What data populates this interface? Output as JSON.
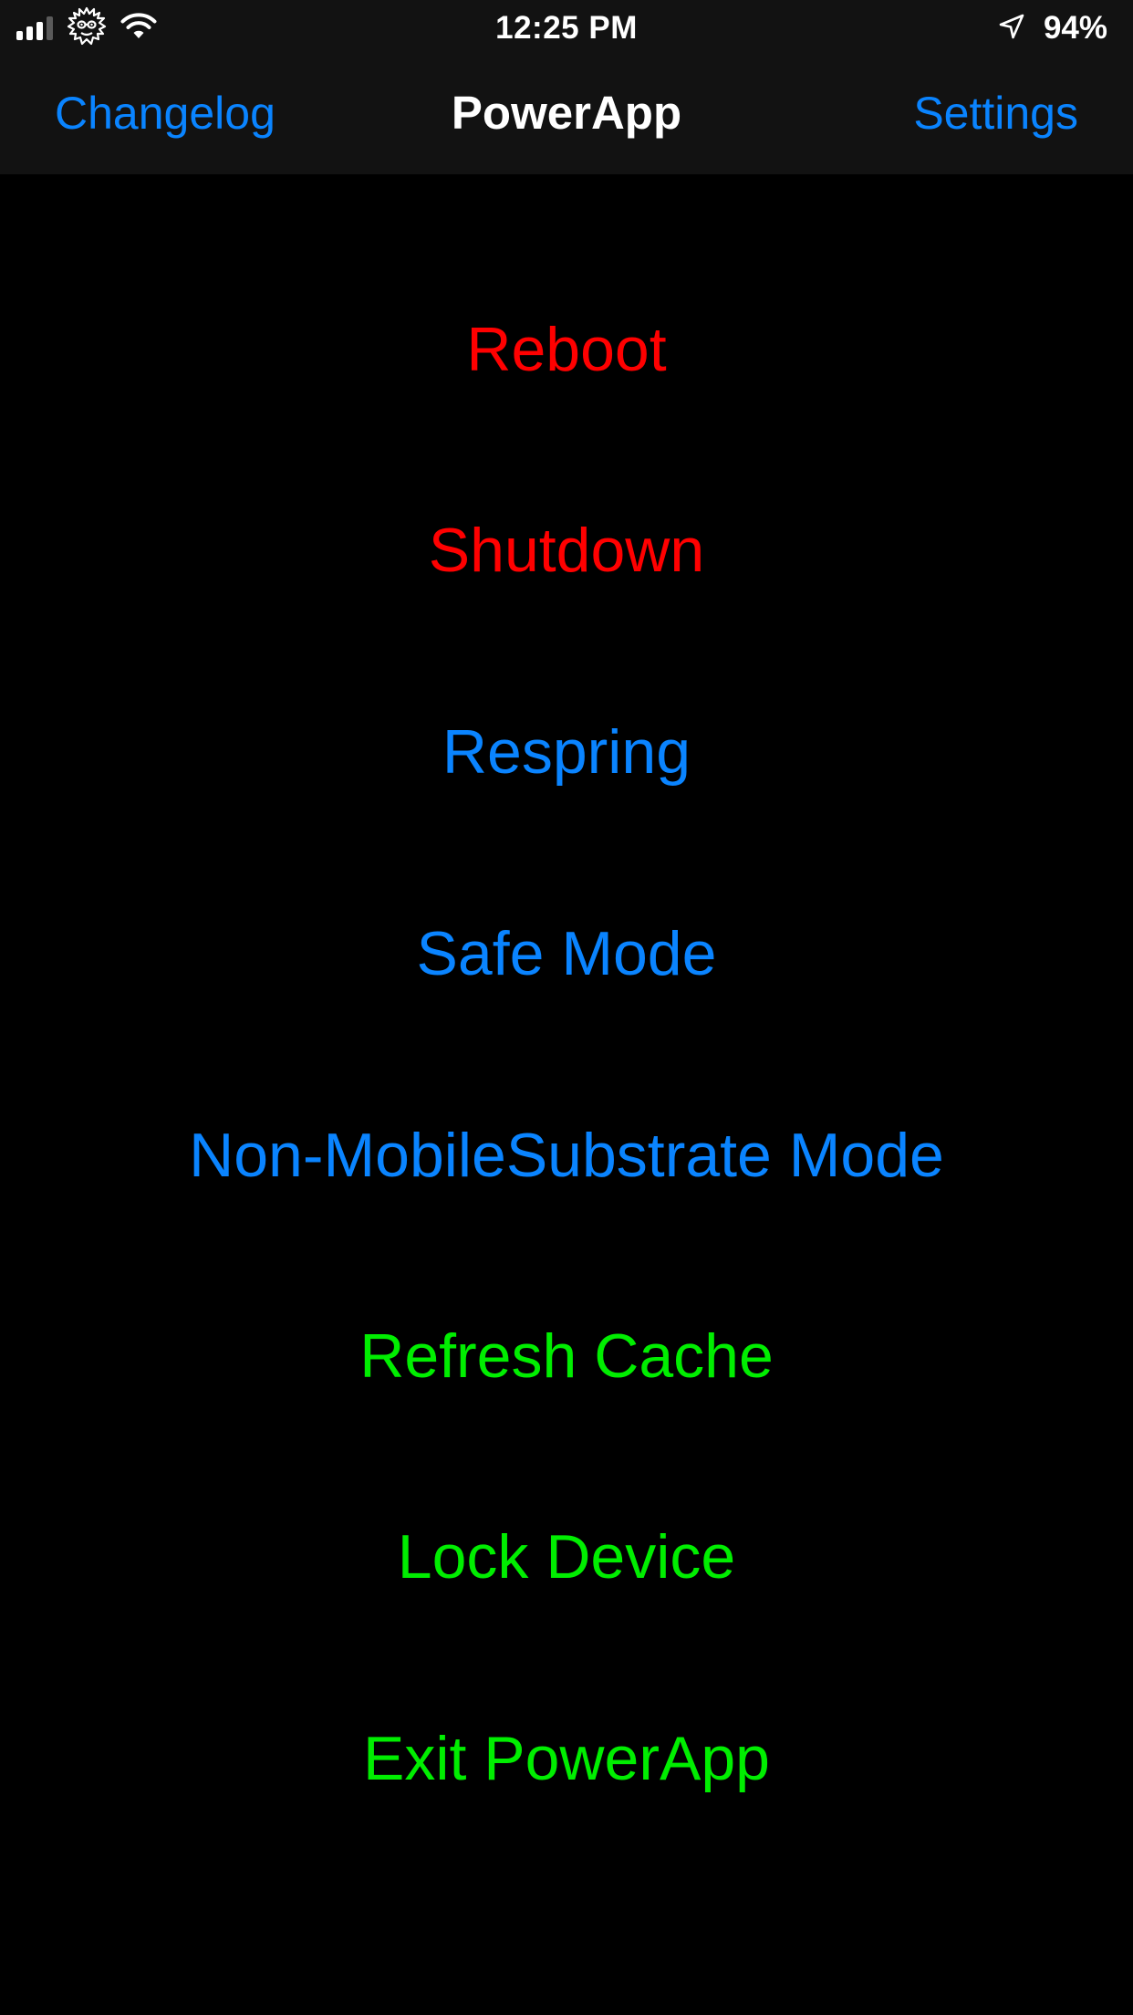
{
  "colors": {
    "accent_blue": "#0a84ff",
    "danger_red": "#ff0000",
    "success_green": "#00ee00",
    "background": "#000000",
    "bar_background": "#121212"
  },
  "status_bar": {
    "time": "12:25 PM",
    "battery": "94%",
    "icons": [
      "cellular-signal-icon",
      "rick-face-icon",
      "wifi-icon",
      "location-arrow-icon"
    ]
  },
  "nav": {
    "left_label": "Changelog",
    "title": "PowerApp",
    "right_label": "Settings"
  },
  "actions": [
    {
      "label": "Reboot",
      "color": "#ff0000"
    },
    {
      "label": "Shutdown",
      "color": "#ff0000"
    },
    {
      "label": "Respring",
      "color": "#0a84ff"
    },
    {
      "label": "Safe Mode",
      "color": "#0a84ff"
    },
    {
      "label": "Non-MobileSubstrate Mode",
      "color": "#0a84ff"
    },
    {
      "label": "Refresh Cache",
      "color": "#00ee00"
    },
    {
      "label": "Lock Device",
      "color": "#00ee00"
    },
    {
      "label": "Exit PowerApp",
      "color": "#00ee00"
    }
  ]
}
